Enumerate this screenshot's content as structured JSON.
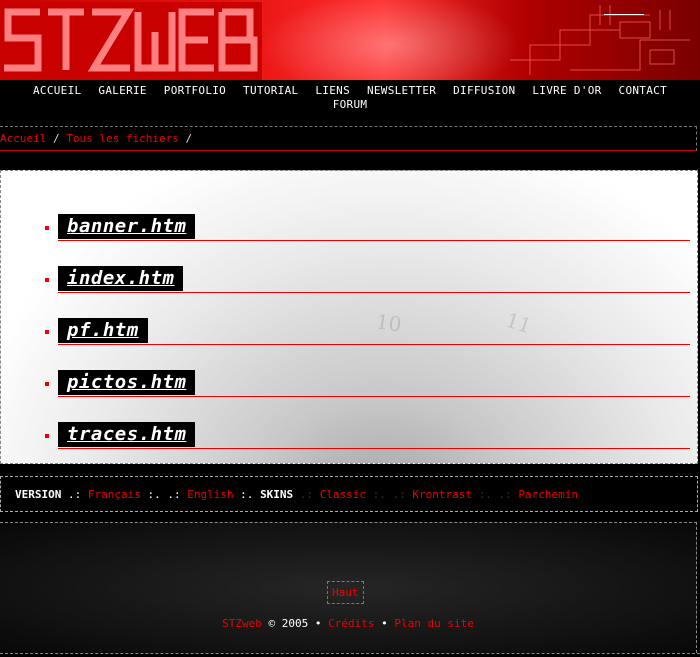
{
  "banner": {
    "logo_text": "STZWEB"
  },
  "nav": {
    "items": [
      "ACCUEIL",
      "GALERIE",
      "PORTFOLIO",
      "TUTORIAL",
      "LIENS",
      "NEWSLETTER",
      "DIFFUSION",
      "LIVRE D'OR",
      "CONTACT",
      "FORUM"
    ]
  },
  "breadcrumb": {
    "home": "Accueil",
    "sep1": " / ",
    "all_files": "Tous les fichiers",
    "sep2": " /"
  },
  "files": [
    "banner.htm",
    "index.htm",
    "pf.htm",
    "pictos.htm",
    "traces.htm"
  ],
  "version_bar": {
    "version_label": "VERSION",
    "sep_a": " .: ",
    "francais": "Français",
    "sep_b": " :. .: ",
    "english": "English",
    "sep_c": " :. ",
    "skins_label": "SKINS",
    "sep_d": " .: ",
    "classic": "Classic",
    "sep_e": " :. .: ",
    "krontrast": "Krontrast",
    "sep_f": " :. .: ",
    "parchemin": "Parchemin"
  },
  "footer": {
    "haut": "Haut",
    "brand": "STZweb",
    "copyright": " © 2005 • ",
    "credits": "Crédits",
    "dot": " • ",
    "plan": "Plan du site"
  },
  "colors": {
    "accent": "#e00000",
    "background": "#000000"
  }
}
